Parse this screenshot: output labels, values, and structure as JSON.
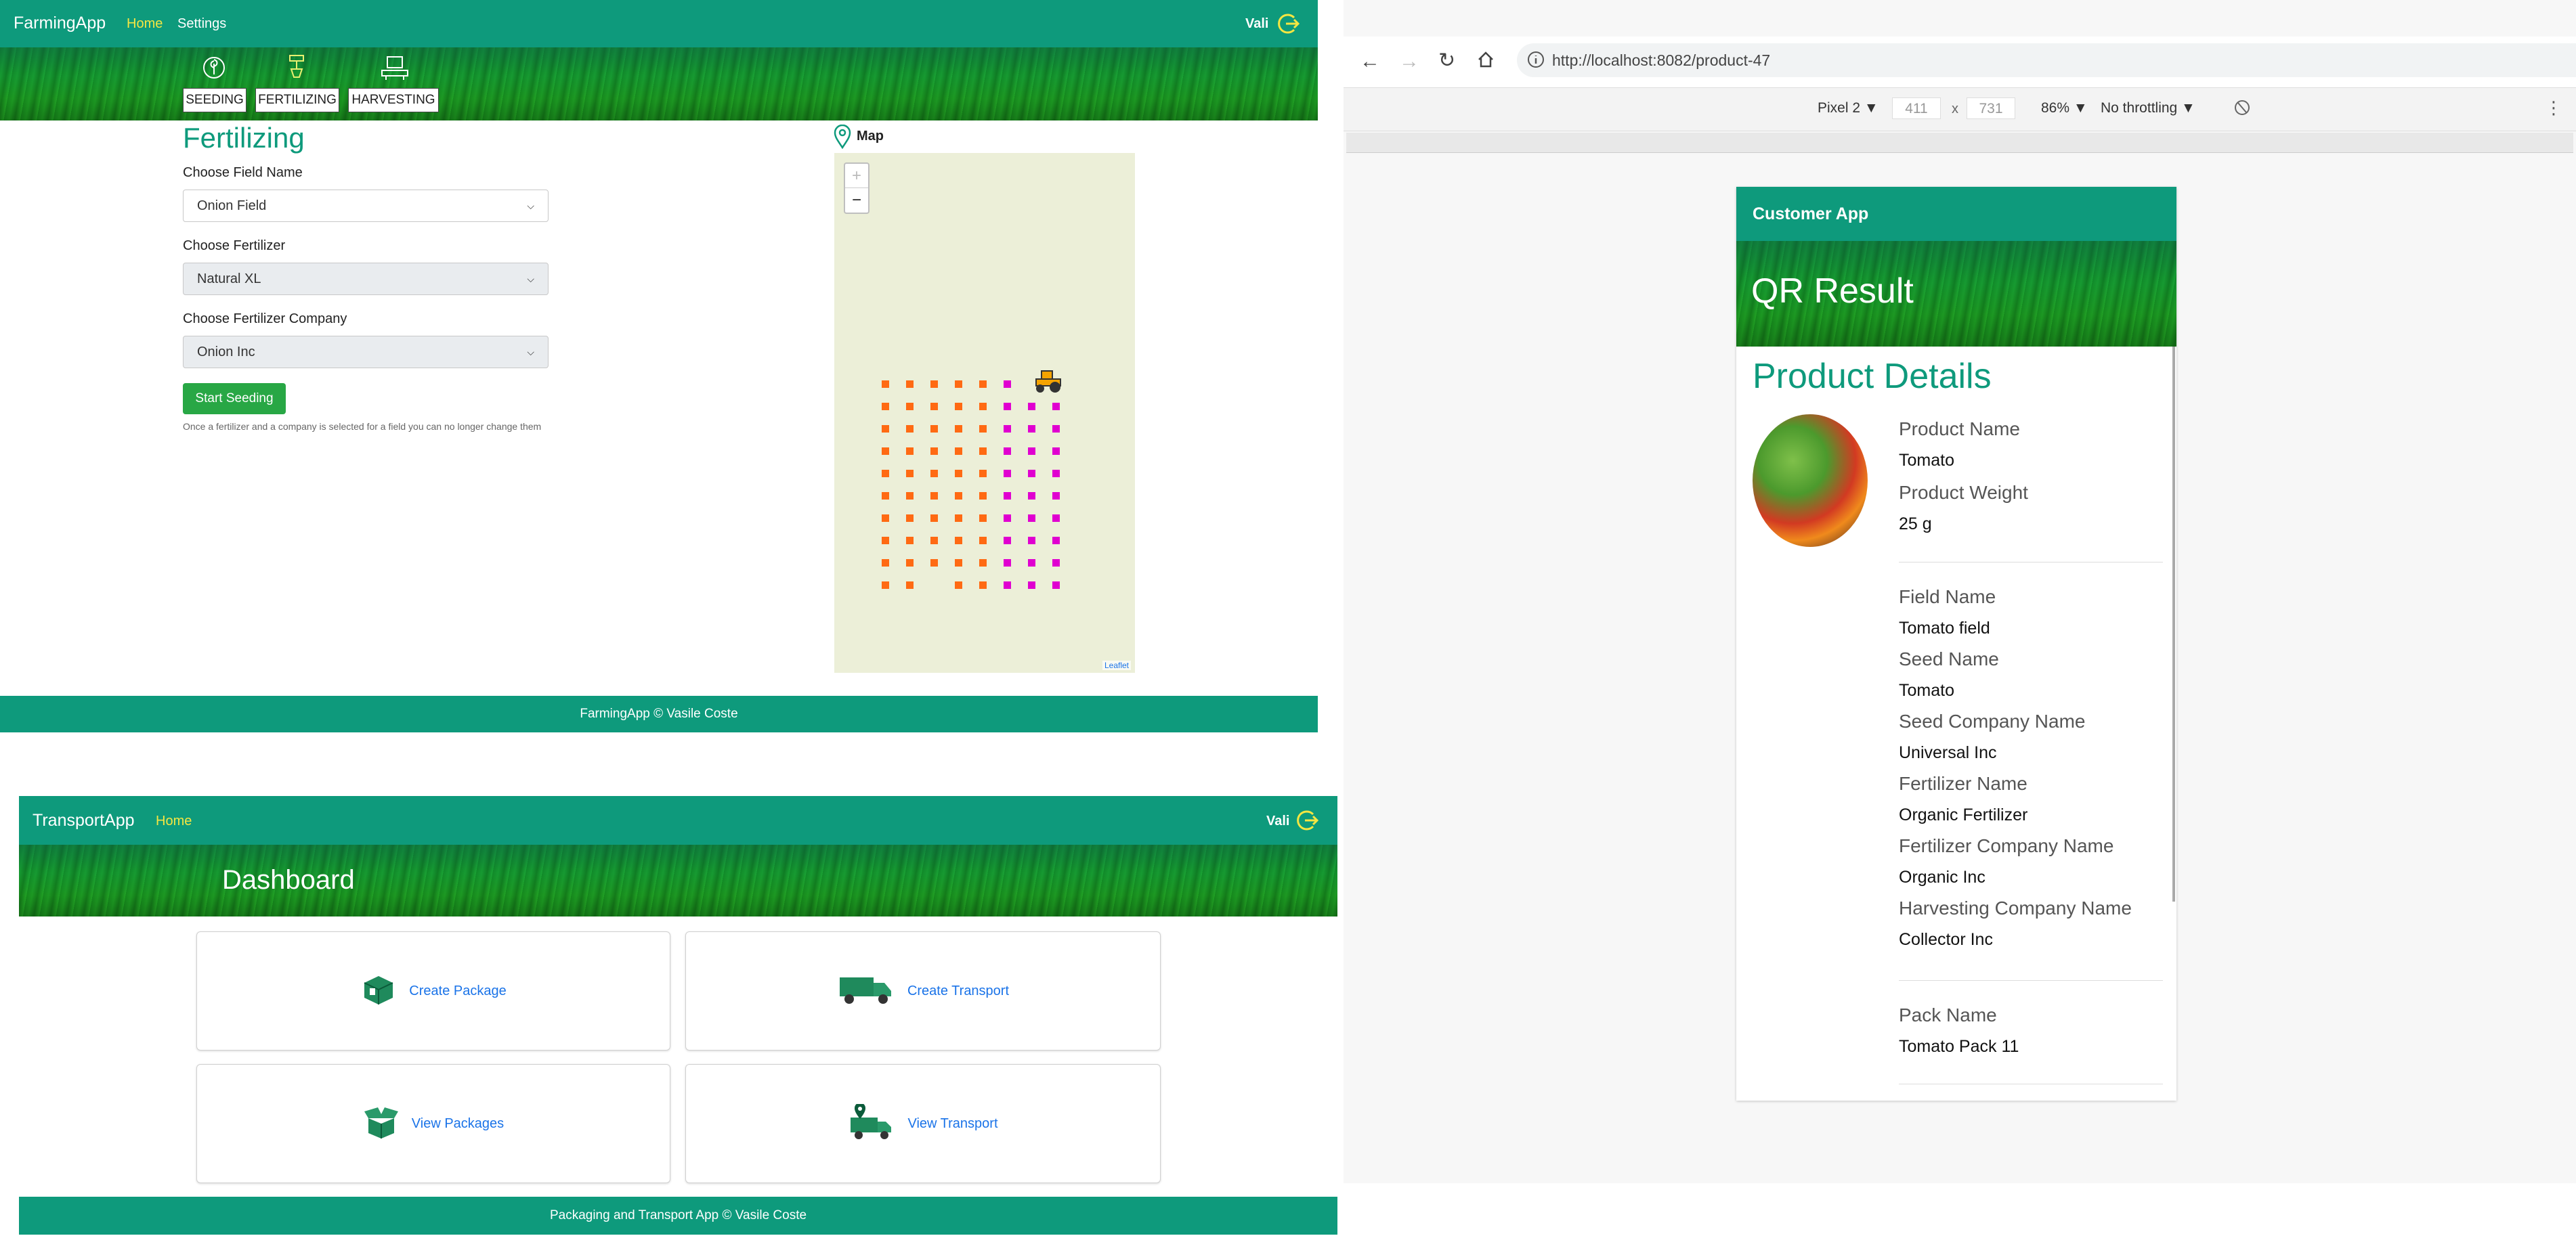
{
  "farming": {
    "brand": "FarmingApp",
    "nav": [
      "Home",
      "Settings"
    ],
    "user": "Vali",
    "tabs": [
      "SEEDING",
      "FERTILIZING",
      "HARVESTING"
    ],
    "title": "Fertilizing",
    "form": {
      "field_label": "Choose Field Name",
      "field_value": "Onion Field",
      "fertilizer_label": "Choose Fertilizer",
      "fertilizer_value": "Natural XL",
      "company_label": "Choose Fertilizer Company",
      "company_value": "Onion Inc",
      "start_button": "Start Seeding",
      "note": "Once a fertilizer and a company is selected for a field you can no longer change them"
    },
    "map": {
      "label": "Map",
      "zoom_in": "+",
      "zoom_out": "−",
      "attribution": "Leaflet",
      "dot_colors": {
        "orange": "#ff6a13",
        "magenta": "#e000d0"
      },
      "tractor_color": "#f5a300"
    },
    "footer": "FarmingApp © Vasile Coste"
  },
  "transport": {
    "brand": "TransportApp",
    "nav": [
      "Home"
    ],
    "user": "Vali",
    "title": "Dashboard",
    "cards": [
      "Create Package",
      "Create Transport",
      "View Packages",
      "View Transport"
    ],
    "footer": "Packaging and Transport App © Vasile Coste"
  },
  "browser": {
    "url": "http://localhost:8082/product-47",
    "device": "Pixel 2 ▼",
    "width": "411",
    "times": "x",
    "height": "731",
    "zoom": "86% ▼",
    "throttle": "No throttling ▼"
  },
  "customer": {
    "brand": "Customer App",
    "banner": "QR Result",
    "title": "Product Details",
    "product": [
      {
        "label": "Product Name",
        "value": "Tomato"
      },
      {
        "label": "Product Weight",
        "value": "25 g"
      }
    ],
    "details": [
      {
        "label": "Field Name",
        "value": "Tomato field"
      },
      {
        "label": "Seed Name",
        "value": "Tomato"
      },
      {
        "label": "Seed Company Name",
        "value": "Universal Inc"
      },
      {
        "label": "Fertilizer Name",
        "value": "Organic Fertilizer"
      },
      {
        "label": "Fertilizer Company Name",
        "value": "Organic Inc"
      },
      {
        "label": "Harvesting Company Name",
        "value": "Collector Inc"
      }
    ],
    "pack": {
      "label": "Pack Name",
      "value": "Tomato Pack 11"
    }
  },
  "colors": {
    "teal": "#0e9a7c",
    "accent_yellow": "#f5e642",
    "heading": "#0e9a7c",
    "link": "#1a73e8"
  }
}
